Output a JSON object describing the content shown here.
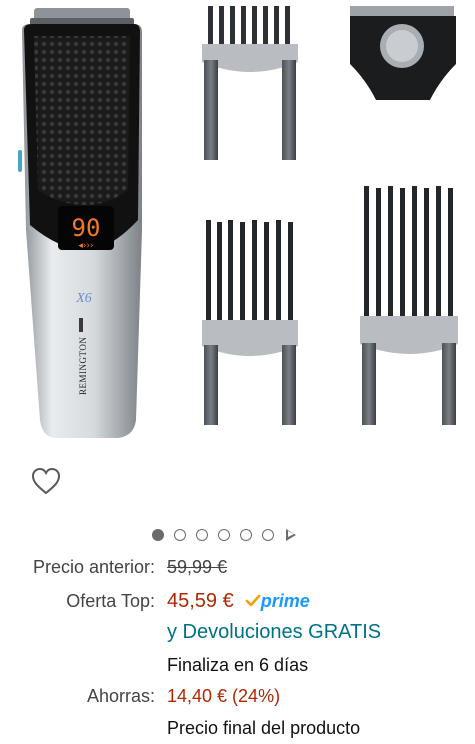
{
  "product": {
    "brand_text": "REMINGTON",
    "model_text": "X6",
    "display_value": "90"
  },
  "carousel": {
    "dot_count": 6,
    "active_index": 0
  },
  "pricing": {
    "previous_label": "Precio anterior:",
    "previous_value": "59,99 €",
    "offer_label": "Oferta Top:",
    "offer_value": "45,59 €",
    "prime_label": "prime",
    "returns_text": "y Devoluciones GRATIS",
    "ends_text": "Finaliza en 6 días",
    "savings_label": "Ahorras:",
    "savings_value": "14,40 € (24%)",
    "final_text": "Precio final del producto"
  },
  "colors": {
    "price_red": "#b12704",
    "link_teal": "#007185",
    "prime_blue": "#1a98ff",
    "check_orange": "#f0a30a"
  }
}
